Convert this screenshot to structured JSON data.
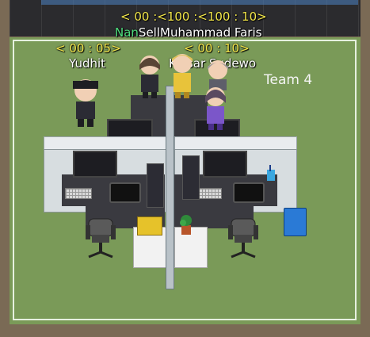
{
  "header": {
    "timer_top": "< 00 :<100 :<100 : 10>",
    "names_nan": "Nan",
    "names_rest": "SellMuhammad Faris"
  },
  "players": [
    {
      "name": "Yudhit",
      "timer": "< 00 : 05>"
    },
    {
      "name": "Kaisar Sudewo",
      "timer": "< 00 : 10>"
    }
  ],
  "zone": {
    "label": "Team 4"
  },
  "colors": {
    "timer": "#f2e64a",
    "nan_name": "#4fe07e",
    "floor": "#7a9a58",
    "zone_border": "#e6f0df"
  }
}
